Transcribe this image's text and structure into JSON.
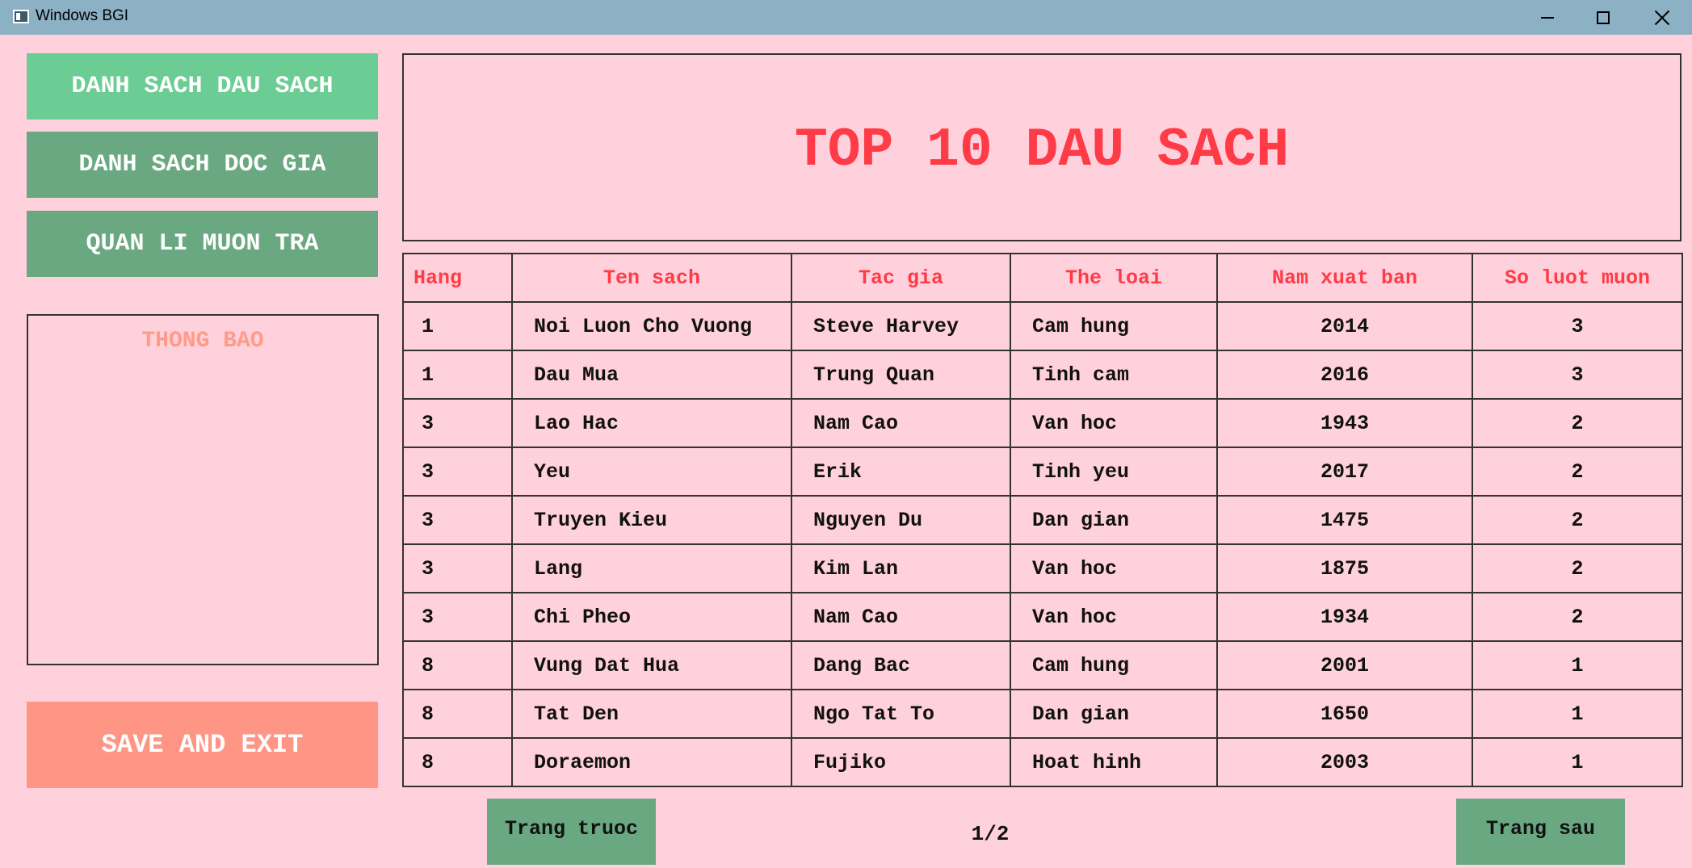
{
  "window": {
    "title": "Windows BGI"
  },
  "sidebar": {
    "nav": [
      {
        "label": "DANH SACH DAU SACH"
      },
      {
        "label": "DANH SACH DOC GIA"
      },
      {
        "label": "QUAN LI MUON TRA"
      }
    ],
    "notice_title": "THONG BAO",
    "save_label": "SAVE AND EXIT"
  },
  "main": {
    "title": "TOP 10 DAU SACH",
    "columns": [
      "Hang",
      "Ten sach",
      "Tac gia",
      "The loai",
      "Nam xuat ban",
      "So luot muon"
    ],
    "rows": [
      [
        "1",
        "Noi Luon Cho Vuong",
        "Steve Harvey",
        "Cam hung",
        "2014",
        "3"
      ],
      [
        "1",
        "Dau Mua",
        "Trung Quan",
        "Tinh cam",
        "2016",
        "3"
      ],
      [
        "3",
        "Lao Hac",
        "Nam Cao",
        "Van hoc",
        "1943",
        "2"
      ],
      [
        "3",
        "Yeu",
        "Erik",
        "Tinh yeu",
        "2017",
        "2"
      ],
      [
        "3",
        "Truyen Kieu",
        "Nguyen Du",
        "Dan gian",
        "1475",
        "2"
      ],
      [
        "3",
        "Lang",
        "Kim Lan",
        "Van hoc",
        "1875",
        "2"
      ],
      [
        "3",
        "Chi Pheo",
        "Nam Cao",
        "Van hoc",
        "1934",
        "2"
      ],
      [
        "8",
        "Vung Dat Hua",
        "Dang Bac",
        "Cam hung",
        "2001",
        "1"
      ],
      [
        "8",
        "Tat Den",
        "Ngo Tat To",
        "Dan gian",
        "1650",
        "1"
      ],
      [
        "8",
        "Doraemon",
        "Fujiko",
        "Hoat hinh",
        "2003",
        "1"
      ]
    ]
  },
  "pagination": {
    "prev_label": "Trang truoc",
    "next_label": "Trang sau",
    "page": "1/2"
  },
  "colors": {
    "background": "#ffd1dc",
    "titlebar": "#8cb1c5",
    "nav_active": "#6ccd94",
    "nav_normal": "#6aa882",
    "save": "#ff9685",
    "heading_red": "#ff3b47",
    "notice_title": "#ff9b87"
  }
}
